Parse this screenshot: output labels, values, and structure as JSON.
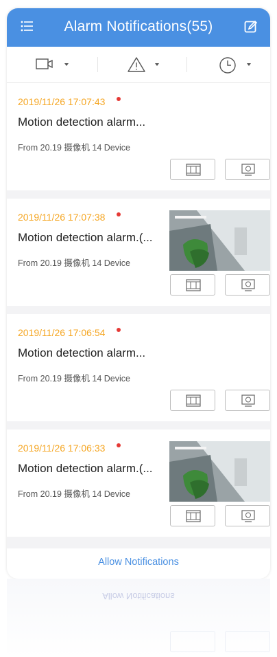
{
  "header": {
    "title": "Alarm Notifications(55)"
  },
  "filters": [
    {
      "name": "camera-filter"
    },
    {
      "name": "alert-filter"
    },
    {
      "name": "time-filter"
    }
  ],
  "notifications": [
    {
      "time": "2019/11/26 17:07:43",
      "label": "Motion detection alarm...",
      "source": "From 20.19 摄像机 14 Device",
      "has_thumb": false
    },
    {
      "time": "2019/11/26 17:07:38",
      "label": "Motion detection alarm.(...",
      "source": "From 20.19 摄像机 14 Device",
      "has_thumb": true
    },
    {
      "time": "2019/11/26 17:06:54",
      "label": "Motion detection alarm...",
      "source": "From 20.19 摄像机 14 Device",
      "has_thumb": false
    },
    {
      "time": "2019/11/26 17:06:33",
      "label": "Motion detection alarm.(...",
      "source": "From 20.19 摄像机 14 Device",
      "has_thumb": true
    }
  ],
  "allow_notifications": "Allow Notifications",
  "reflection_text": "Allow Notifications",
  "colors": {
    "header": "#4a90e2",
    "time": "#f5a623",
    "dot": "#e53935",
    "link": "#4a90e2"
  }
}
